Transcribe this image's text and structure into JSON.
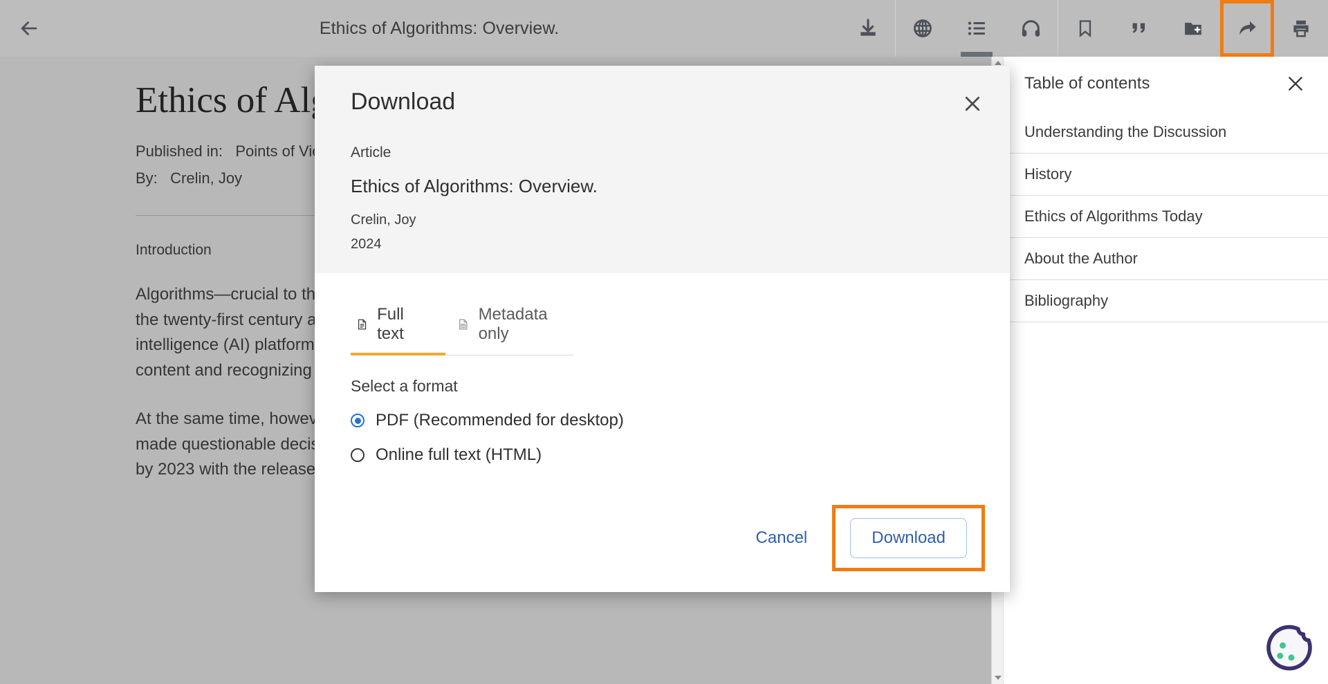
{
  "toolbar": {
    "back_icon": "arrow-left-icon",
    "title": "Ethics of Algorithms: Overview.",
    "buttons": [
      {
        "name": "download",
        "label": "Download",
        "icon": "download-icon",
        "active": false,
        "highlighted": false
      },
      {
        "name": "translate",
        "label": "Translate",
        "icon": "globe-icon",
        "active": false,
        "highlighted": false
      },
      {
        "name": "table-of-contents",
        "label": "Table of contents",
        "icon": "list-icon",
        "active": true,
        "highlighted": false
      },
      {
        "name": "listen",
        "label": "Listen",
        "icon": "headphones-icon",
        "active": false,
        "highlighted": false
      },
      {
        "name": "save",
        "label": "Save",
        "icon": "bookmark-icon",
        "active": false,
        "highlighted": false
      },
      {
        "name": "cite",
        "label": "Cite",
        "icon": "quote-icon",
        "active": false,
        "highlighted": false
      },
      {
        "name": "add-to-folder",
        "label": "Add to folder",
        "icon": "folder-plus-icon",
        "active": false,
        "highlighted": false
      },
      {
        "name": "share",
        "label": "Share",
        "icon": "share-arrow-icon",
        "active": false,
        "highlighted": true
      },
      {
        "name": "print",
        "label": "Print",
        "icon": "printer-icon",
        "active": false,
        "highlighted": false
      }
    ]
  },
  "article": {
    "title": "Ethics of Algorithms: Overview.",
    "published_label": "Published in:",
    "published_value": "Points of View",
    "by_label": "By:",
    "by_value": "Crelin, Joy",
    "section_heading": "Introduction",
    "paragraph_1": "Algorithms—crucial to the functioning of modern computing—took on even greater importance in the twenty-first century as technology companies developed new systems, such as artificial intelligence (AI) platforms, that became increasingly complex, including serving social media content and recognizing images of human faces.",
    "paragraph_2": "At the same time, however, the ethical implications of algorithms grew more pressing as they made questionable decisions based on biased data. This debate had particularly been stimulated by 2023 with the release and relatively widespread adoption of the artificial-"
  },
  "toc": {
    "title": "Table of contents",
    "close_icon": "close-icon",
    "items": [
      "Understanding the Discussion",
      "History",
      "Ethics of Algorithms Today",
      "About the Author",
      "Bibliography"
    ]
  },
  "scrollbar": {
    "up_icon": "triangle-up-icon",
    "down_icon": "triangle-down-icon"
  },
  "modal": {
    "title": "Download",
    "close_icon": "close-icon",
    "record_kind": "Article",
    "record_title": "Ethics of Algorithms: Overview.",
    "record_author": "Crelin, Joy",
    "record_year": "2024",
    "tabs": [
      {
        "label": "Full text",
        "icon": "document-text-icon",
        "active": true
      },
      {
        "label": "Metadata only",
        "icon": "document-table-icon",
        "active": false
      }
    ],
    "format_label": "Select a format",
    "options": [
      {
        "label": "PDF (Recommended for desktop)",
        "selected": true
      },
      {
        "label": "Online full text (HTML)",
        "selected": false
      }
    ],
    "cancel_label": "Cancel",
    "download_label": "Download"
  },
  "cookie": {
    "icon": "cookie-icon"
  },
  "colors": {
    "highlight": "#f07c12",
    "tab_accent": "#f0a830",
    "link_blue": "#2f5fb0",
    "radio_blue": "#2470d6",
    "toolbar_icon": "#4c5159"
  }
}
